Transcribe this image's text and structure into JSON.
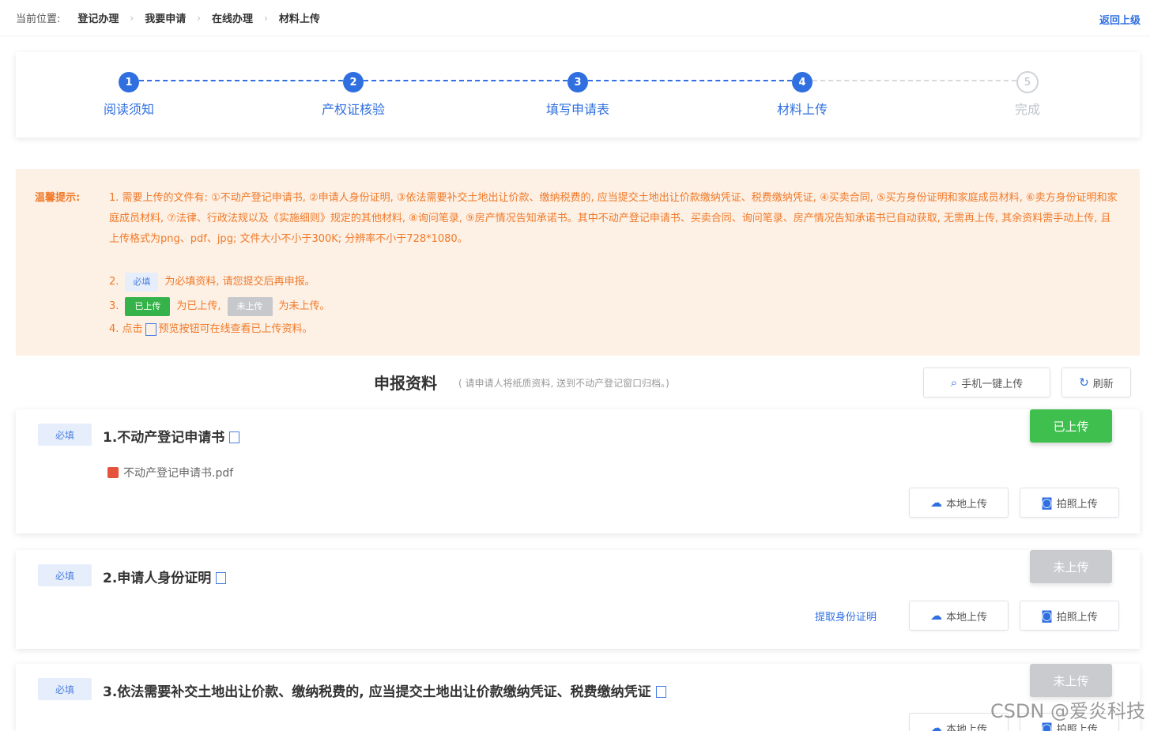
{
  "breadcrumb": {
    "label": "当前位置:",
    "items": [
      "登记办理",
      "我要申请",
      "在线办理",
      "材料上传"
    ],
    "right_link": "返回上级"
  },
  "steps": [
    {
      "num": "1",
      "label": "阅读须知",
      "state": "active"
    },
    {
      "num": "2",
      "label": "产权证核验",
      "state": "active"
    },
    {
      "num": "3",
      "label": "填写申请表",
      "state": "active"
    },
    {
      "num": "4",
      "label": "材料上传",
      "state": "active"
    },
    {
      "num": "5",
      "label": "完成",
      "state": "pending"
    }
  ],
  "tips": {
    "title": "温馨提示:",
    "item1": "1. 需要上传的文件有: ①不动产登记申请书, ②申请人身份证明, ③依法需要补交土地出让价款、缴纳税费的, 应当提交土地出让价款缴纳凭证、税费缴纳凭证, ④买卖合同, ⑤买方身份证明和家庭成员材料, ⑥卖方身份证明和家庭成员材料, ⑦法律、行政法规以及《实施细则》规定的其他材料, ⑧询问笔录, ⑨房产情况告知承诺书。其中不动产登记申请书、买卖合同、询问笔录、房产情况告知承诺书已自动获取, 无需再上传, 其余资料需手动上传, 且上传格式为png、pdf、jpg; 文件大小不小于300K; 分辨率不小于728*1080。",
    "item2_prefix": "2.",
    "item2_tag": "必填",
    "item2_text": "为必填资料, 请您提交后再申报。",
    "item3_prefix": "3.",
    "item3_tag_up": "已上传",
    "item3_text_up": "为已上传,",
    "item3_tag_notup": "未上传",
    "item3_text_notup": "为未上传。",
    "item4_prefix": "4. 点击",
    "item4_text": "预览按钮可在线查看已上传资料。"
  },
  "section": {
    "title": "申报资料",
    "subtitle": "( 请申请人将纸质资料, 送到不动产登记窗口归档。)",
    "mobile_upload": "手机一键上传",
    "refresh": "刷新"
  },
  "materials": [
    {
      "tag": "必填",
      "title": "1.不动产登记申请书",
      "status": "已上传",
      "file": "不动产登记申请书.pdf",
      "local_upload": "本地上传",
      "photo_upload": "拍照上传"
    },
    {
      "tag": "必填",
      "title": "2.申请人身份证明",
      "status": "未上传",
      "fetch_link": "提取身份证明",
      "local_upload": "本地上传",
      "photo_upload": "拍照上传"
    },
    {
      "tag": "必填",
      "title": "3.依法需要补交土地出让价款、缴纳税费的, 应当提交土地出让价款缴纳凭证、税费缴纳凭证",
      "status": "未上传",
      "local_upload": "本地上传",
      "photo_upload": "拍照上传"
    }
  ],
  "watermark": "CSDN @爱炎科技",
  "colors": {
    "primary": "#2f6fe0",
    "tip_bg": "#fdf0e4",
    "tip_text": "#f07a2a",
    "uploaded": "#3fbf4e",
    "not_uploaded": "#c9cbcf"
  }
}
